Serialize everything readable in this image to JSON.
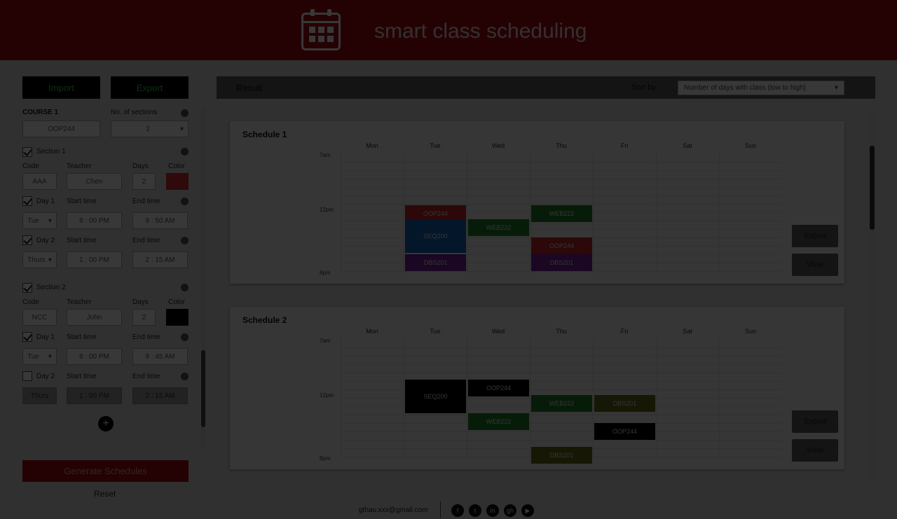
{
  "app": {
    "title": "smart class scheduling"
  },
  "left": {
    "import_label": "Import",
    "export_label": "Export",
    "course_label": "COURSE 1",
    "sections_label": "No. of sections",
    "course_value": "OOP244",
    "sections_value": "2",
    "section1": {
      "label": "Section 1",
      "code_label": "Code",
      "teacher_label": "Teacher",
      "days_label": "Days",
      "color_label": "Color",
      "code": "AAA",
      "teacher": "Chen",
      "days": "2",
      "color": "#d32f2f",
      "day1": {
        "label": "Day 1",
        "start_label": "Start time",
        "end_label": "End time",
        "day": "Tue",
        "start": "8 : 00 PM",
        "end": "9 : 50 AM"
      },
      "day2": {
        "label": "Day 2",
        "start_label": "Start time",
        "end_label": "End time",
        "day": "Thurs",
        "start": "1 : 00 PM",
        "end": "2 : 15 AM"
      }
    },
    "section2": {
      "label": "Section 2",
      "code_label": "Code",
      "teacher_label": "Teacher",
      "days_label": "Days",
      "color_label": "Color",
      "code": "NCC",
      "teacher": "John",
      "days": "2",
      "color": "#000000",
      "day1": {
        "label": "Day 1",
        "start_label": "Start time",
        "end_label": "End time",
        "day": "Tue",
        "start": "8 : 00 PM",
        "end": "9 : 45 AM"
      },
      "day2": {
        "label": "Day 2",
        "start_label": "Start time",
        "end_label": "End time",
        "day": "Thurs",
        "start": "1 : 00 PM",
        "end": "2 : 15 AM"
      }
    },
    "generate_label": "Generate Schedules",
    "reset_label": "Reset"
  },
  "result": {
    "title": "Result",
    "sort_label": "Sort by:",
    "sort_value": "Number of days with class (low to high)",
    "days": [
      "Mon",
      "Tue",
      "Wed",
      "Thu",
      "Fri",
      "Sat",
      "Sun"
    ],
    "times": [
      "7am",
      "12pm",
      "8pm"
    ],
    "export_label": "Export",
    "view_label": "View",
    "schedules": [
      {
        "title": "Schedule 1",
        "events": [
          {
            "label": "OOP244",
            "day": 1,
            "row": 3,
            "rows": 1,
            "color": "#c62828"
          },
          {
            "label": "SEQ200",
            "day": 1,
            "row": 4,
            "rows": 2,
            "color": "#1565c0"
          },
          {
            "label": "DBS201",
            "day": 1,
            "row": 6.5,
            "rows": 1,
            "color": "#7b1fa2"
          },
          {
            "label": "WEB222",
            "day": 2,
            "row": 4,
            "rows": 1,
            "color": "#1b7f2a"
          },
          {
            "label": "WEB222",
            "day": 3,
            "row": 3,
            "rows": 1,
            "color": "#1b7f2a"
          },
          {
            "label": "OOP244",
            "day": 3,
            "row": 5.3,
            "rows": 1,
            "color": "#c62828"
          },
          {
            "label": "DBS201",
            "day": 3,
            "row": 6.5,
            "rows": 1,
            "color": "#7b1fa2"
          }
        ]
      },
      {
        "title": "Schedule 2",
        "events": [
          {
            "label": "SEQ200",
            "day": 1,
            "row": 2.2,
            "rows": 2,
            "color": "#000000"
          },
          {
            "label": "OOP244",
            "day": 2,
            "row": 2.2,
            "rows": 1,
            "color": "#000000"
          },
          {
            "label": "WEB222",
            "day": 2,
            "row": 4.6,
            "rows": 1,
            "color": "#1b7f2a"
          },
          {
            "label": "WEB222",
            "day": 3,
            "row": 3.3,
            "rows": 1,
            "color": "#1b7f2a"
          },
          {
            "label": "DBS201",
            "day": 4,
            "row": 3.3,
            "rows": 1,
            "color": "#6b6b1a"
          },
          {
            "label": "OOP244",
            "day": 4,
            "row": 5.3,
            "rows": 1,
            "color": "#000000"
          },
          {
            "label": "DBS201",
            "day": 3,
            "row": 7,
            "rows": 1,
            "color": "#6b6b1a"
          }
        ]
      }
    ]
  },
  "footer": {
    "email": "gthau.xxx@gmail.com",
    "social": [
      "facebook-icon",
      "twitter-icon",
      "linkedin-icon",
      "github-icon",
      "youtube-icon"
    ]
  }
}
